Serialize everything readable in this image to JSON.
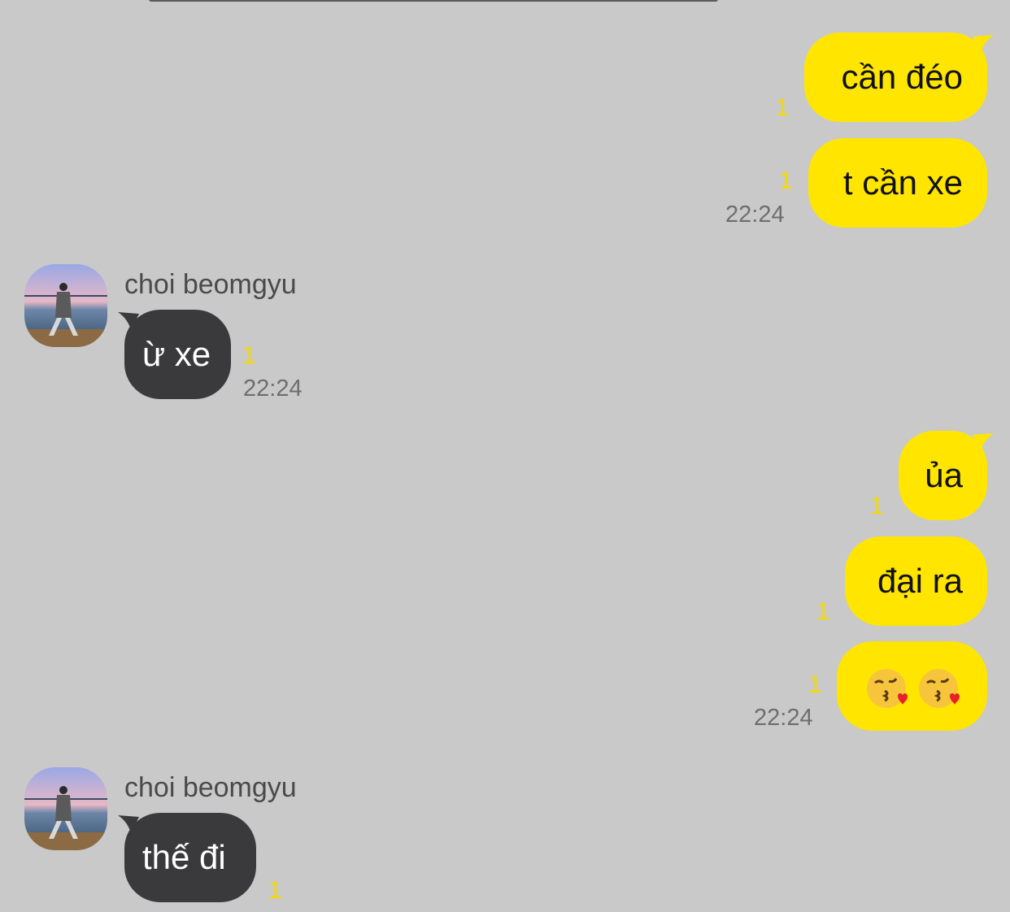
{
  "colors": {
    "background": "#c9c9c9",
    "my_bubble": "#ffe500",
    "their_bubble": "#3a3a3c",
    "unread_count": "#f4d800",
    "timestamp": "#6e6e6e"
  },
  "messages": [
    {
      "from": "me",
      "text": "cần đéo",
      "unread": "1"
    },
    {
      "from": "me",
      "text": "t cần xe",
      "unread": "1",
      "time": "22:24"
    },
    {
      "from": "them",
      "sender": "choi beomgyu",
      "text": "ừ xe",
      "unread": "1",
      "time": "22:24"
    },
    {
      "from": "me",
      "text": "ủa",
      "unread": "1"
    },
    {
      "from": "me",
      "text": "đại ra",
      "unread": "1"
    },
    {
      "from": "me",
      "emojis": [
        "face-blowing-a-kiss",
        "face-blowing-a-kiss"
      ],
      "unread": "1",
      "time": "22:24"
    },
    {
      "from": "them",
      "sender": "choi beomgyu",
      "text": "thế đi",
      "unread": "1"
    }
  ]
}
